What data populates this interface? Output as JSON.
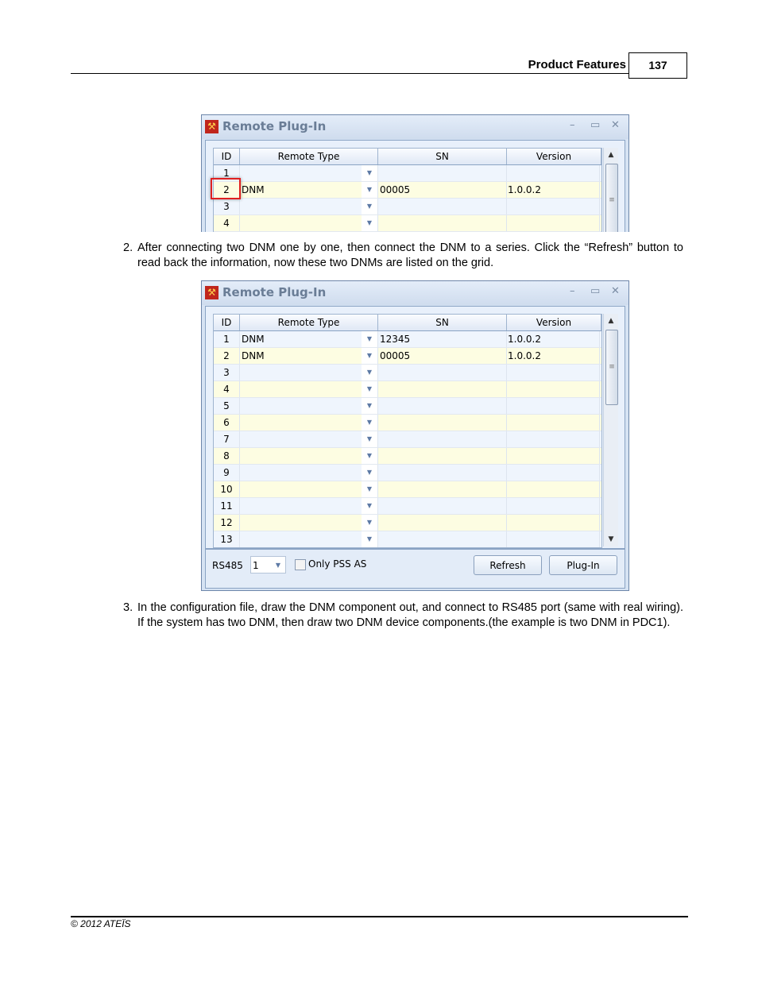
{
  "header": {
    "title": "Product Features",
    "page_number": "137"
  },
  "footer": {
    "copyright": "© 2012 ATEÏS"
  },
  "steps": [
    {
      "num": "2.",
      "text": "After connecting two DNM one by one, then connect the DNM to a series. Click the  “Refresh” button to read back the information, now these two DNMs are listed on the grid."
    },
    {
      "num": "3.",
      "text": "In the configuration file, draw the DNM component out, and connect to RS485 port (same with real wiring).  If the system has two DNM, then draw two DNM device components.(the example is two DNM in PDC1)."
    }
  ],
  "window": {
    "title": "Remote Plug-In",
    "minimize": "–",
    "maximize": "▭",
    "close": "✕"
  },
  "columns": [
    "ID",
    "Remote Type",
    "SN",
    "Version"
  ],
  "screenshot1": {
    "highlighted_row": 2,
    "rows": [
      {
        "id": "1",
        "type": "",
        "sn": "",
        "version": ""
      },
      {
        "id": "2",
        "type": "DNM",
        "sn": "00005",
        "version": "1.0.0.2"
      },
      {
        "id": "3",
        "type": "",
        "sn": "",
        "version": ""
      },
      {
        "id": "4",
        "type": "",
        "sn": "",
        "version": ""
      }
    ]
  },
  "screenshot2": {
    "rows": [
      {
        "id": "1",
        "type": "DNM",
        "sn": "12345",
        "version": "1.0.0.2"
      },
      {
        "id": "2",
        "type": "DNM",
        "sn": "00005",
        "version": "1.0.0.2"
      },
      {
        "id": "3",
        "type": "",
        "sn": "",
        "version": ""
      },
      {
        "id": "4",
        "type": "",
        "sn": "",
        "version": ""
      },
      {
        "id": "5",
        "type": "",
        "sn": "",
        "version": ""
      },
      {
        "id": "6",
        "type": "",
        "sn": "",
        "version": ""
      },
      {
        "id": "7",
        "type": "",
        "sn": "",
        "version": ""
      },
      {
        "id": "8",
        "type": "",
        "sn": "",
        "version": ""
      },
      {
        "id": "9",
        "type": "",
        "sn": "",
        "version": ""
      },
      {
        "id": "10",
        "type": "",
        "sn": "",
        "version": ""
      },
      {
        "id": "11",
        "type": "",
        "sn": "",
        "version": ""
      },
      {
        "id": "12",
        "type": "",
        "sn": "",
        "version": ""
      },
      {
        "id": "13",
        "type": "",
        "sn": "",
        "version": ""
      }
    ],
    "rs485_label": "RS485",
    "rs485_value": "1",
    "only_pss_label": "Only PSS AS",
    "only_pss_checked": false,
    "refresh_label": "Refresh",
    "plugin_label": "Plug-In"
  },
  "colors": {
    "highlight": "#e02020",
    "row_odd": "#eff5fd",
    "row_even": "#fdfde2"
  }
}
